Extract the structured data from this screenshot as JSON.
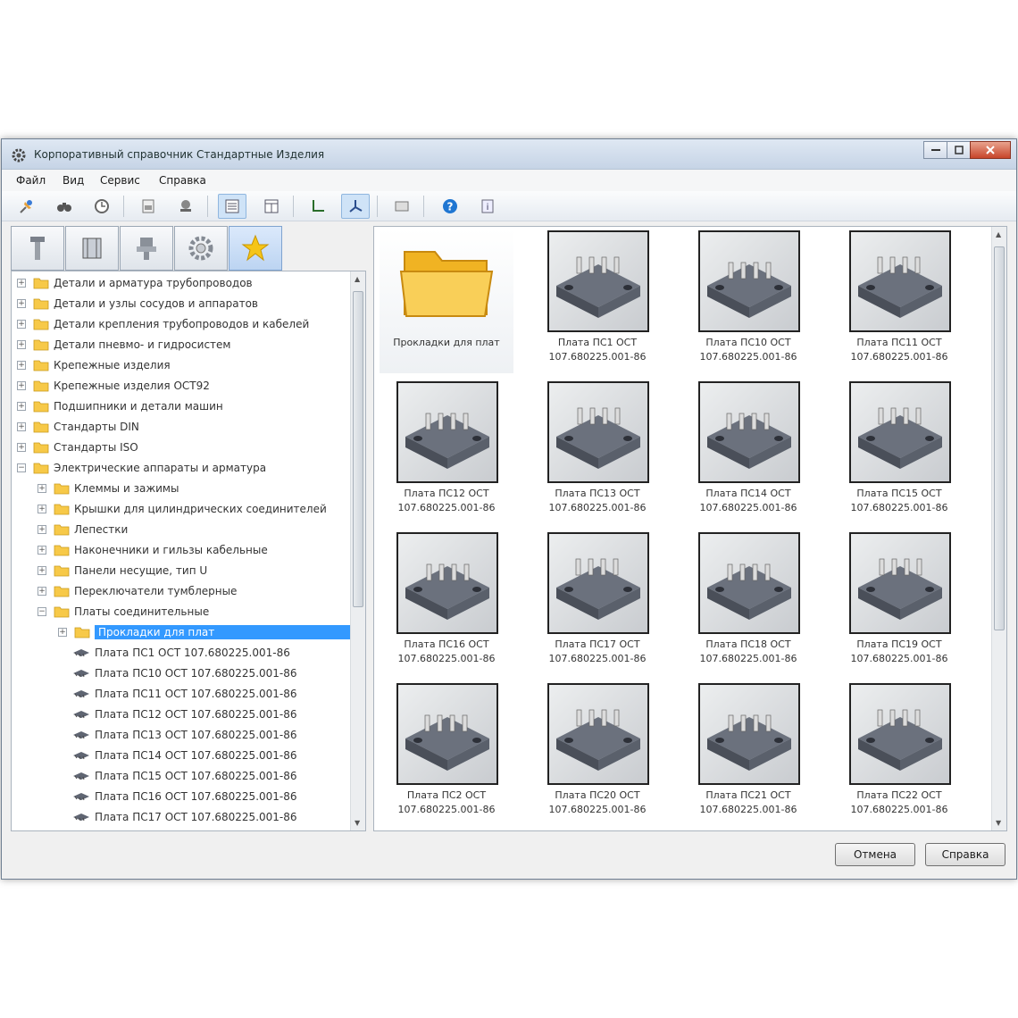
{
  "window": {
    "title": "Корпоративный справочник Стандартные Изделия"
  },
  "menu": [
    "Файл",
    "Вид",
    "Сервис",
    "Справка"
  ],
  "toolbar_icons": [
    "pin-icon",
    "binoculars-icon",
    "clock-icon",
    "page-icon",
    "stamp-icon",
    "list-view-icon",
    "table-view-icon",
    "axis-2d-icon",
    "axis-3d-icon",
    "preview-icon",
    "help-icon",
    "info-icon"
  ],
  "tabs": [
    "bolt-icon",
    "book-icon",
    "part-icon",
    "gear-icon",
    "star-icon"
  ],
  "tree": [
    {
      "label": "Детали и арматура трубопроводов",
      "level": 0,
      "kind": "folder",
      "expander": "+"
    },
    {
      "label": "Детали и узлы сосудов и аппаратов",
      "level": 0,
      "kind": "folder",
      "expander": "+"
    },
    {
      "label": "Детали крепления трубопроводов и кабелей",
      "level": 0,
      "kind": "folder",
      "expander": "+"
    },
    {
      "label": "Детали пневмо- и гидросистем",
      "level": 0,
      "kind": "folder",
      "expander": "+"
    },
    {
      "label": "Крепежные изделия",
      "level": 0,
      "kind": "folder",
      "expander": "+"
    },
    {
      "label": "Крепежные изделия ОСТ92",
      "level": 0,
      "kind": "folder",
      "expander": "+"
    },
    {
      "label": "Подшипники и детали машин",
      "level": 0,
      "kind": "folder",
      "expander": "+"
    },
    {
      "label": "Стандарты DIN",
      "level": 0,
      "kind": "folder",
      "expander": "+"
    },
    {
      "label": "Стандарты ISO",
      "level": 0,
      "kind": "folder",
      "expander": "+"
    },
    {
      "label": "Электрические аппараты и арматура",
      "level": 0,
      "kind": "folder",
      "expander": "−"
    },
    {
      "label": "Клеммы и зажимы",
      "level": 1,
      "kind": "folder",
      "expander": "+"
    },
    {
      "label": "Крышки для цилиндрических соединителей",
      "level": 1,
      "kind": "folder",
      "expander": "+"
    },
    {
      "label": "Лепестки",
      "level": 1,
      "kind": "folder",
      "expander": "+"
    },
    {
      "label": "Наконечники и гильзы кабельные",
      "level": 1,
      "kind": "folder",
      "expander": "+"
    },
    {
      "label": "Панели несущие, тип U",
      "level": 1,
      "kind": "folder",
      "expander": "+"
    },
    {
      "label": "Переключатели тумблерные",
      "level": 1,
      "kind": "folder",
      "expander": "+"
    },
    {
      "label": "Платы соединительные",
      "level": 1,
      "kind": "folder",
      "expander": "−"
    },
    {
      "label": "Прокладки для плат",
      "level": 2,
      "kind": "folder",
      "expander": "+",
      "selected": true
    },
    {
      "label": "Плата ПС1 ОСТ 107.680225.001-86",
      "level": 2,
      "kind": "part"
    },
    {
      "label": "Плата ПС10 ОСТ 107.680225.001-86",
      "level": 2,
      "kind": "part"
    },
    {
      "label": "Плата ПС11  ОСТ 107.680225.001-86",
      "level": 2,
      "kind": "part"
    },
    {
      "label": "Плата ПС12 ОСТ 107.680225.001-86",
      "level": 2,
      "kind": "part"
    },
    {
      "label": "Плата ПС13 ОСТ 107.680225.001-86",
      "level": 2,
      "kind": "part"
    },
    {
      "label": "Плата ПС14 ОСТ 107.680225.001-86",
      "level": 2,
      "kind": "part"
    },
    {
      "label": "Плата ПС15 ОСТ 107.680225.001-86",
      "level": 2,
      "kind": "part"
    },
    {
      "label": "Плата ПС16 ОСТ 107.680225.001-86",
      "level": 2,
      "kind": "part"
    },
    {
      "label": "Плата ПС17 ОСТ 107.680225.001-86",
      "level": 2,
      "kind": "part"
    }
  ],
  "gallery": [
    {
      "line1": "Прокладки для плат",
      "line2": "",
      "kind": "folder"
    },
    {
      "line1": "Плата ПС1 ОСТ",
      "line2": "107.680225.001-86",
      "kind": "part"
    },
    {
      "line1": "Плата ПС10 ОСТ",
      "line2": "107.680225.001-86",
      "kind": "part"
    },
    {
      "line1": "Плата ПС11  ОСТ",
      "line2": "107.680225.001-86",
      "kind": "part"
    },
    {
      "line1": "Плата ПС12 ОСТ",
      "line2": "107.680225.001-86",
      "kind": "part"
    },
    {
      "line1": "Плата ПС13 ОСТ",
      "line2": "107.680225.001-86",
      "kind": "part"
    },
    {
      "line1": "Плата ПС14 ОСТ",
      "line2": "107.680225.001-86",
      "kind": "part"
    },
    {
      "line1": "Плата ПС15 ОСТ",
      "line2": "107.680225.001-86",
      "kind": "part"
    },
    {
      "line1": "Плата ПС16 ОСТ",
      "line2": "107.680225.001-86",
      "kind": "part"
    },
    {
      "line1": "Плата ПС17 ОСТ",
      "line2": "107.680225.001-86",
      "kind": "part"
    },
    {
      "line1": "Плата ПС18 ОСТ",
      "line2": "107.680225.001-86",
      "kind": "part"
    },
    {
      "line1": "Плата ПС19 ОСТ",
      "line2": "107.680225.001-86",
      "kind": "part"
    },
    {
      "line1": "Плата ПС2 ОСТ",
      "line2": "107.680225.001-86",
      "kind": "part"
    },
    {
      "line1": "Плата ПС20 ОСТ",
      "line2": "107.680225.001-86",
      "kind": "part"
    },
    {
      "line1": "Плата ПС21 ОСТ",
      "line2": "107.680225.001-86",
      "kind": "part"
    },
    {
      "line1": "Плата ПС22 ОСТ",
      "line2": "107.680225.001-86",
      "kind": "part"
    }
  ],
  "buttons": {
    "cancel": "Отмена",
    "help": "Справка"
  },
  "colors": {
    "selection": "#3399ff",
    "folder": "#f7c948",
    "part": "#5f6572"
  }
}
